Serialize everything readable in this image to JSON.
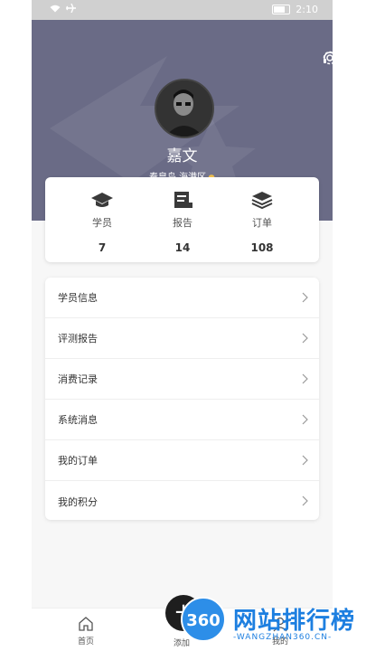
{
  "status_bar": {
    "time": "2:10"
  },
  "profile": {
    "name": "嘉文",
    "location": "秦皇岛 海港区"
  },
  "stats": [
    {
      "label": "学员",
      "value": "7",
      "icon": "graduation-cap-icon"
    },
    {
      "label": "报告",
      "value": "14",
      "icon": "report-icon"
    },
    {
      "label": "订单",
      "value": "108",
      "icon": "layers-icon"
    }
  ],
  "menu": [
    {
      "label": "学员信息"
    },
    {
      "label": "评测报告"
    },
    {
      "label": "消费记录"
    },
    {
      "label": "系统消息"
    },
    {
      "label": "我的订单"
    },
    {
      "label": "我的积分"
    }
  ],
  "tabs": [
    {
      "label": "首页",
      "icon": "home-icon"
    },
    {
      "label": "添加",
      "icon": "plus-icon"
    },
    {
      "label": "我的",
      "icon": "user-icon"
    }
  ],
  "watermark": {
    "logo": "360",
    "title": "网站排行榜",
    "sub": "-WANGZHAN360.CN-"
  },
  "colors": {
    "header_bg": "#6a6b86",
    "accent": "#1d7fe0",
    "pin": "#f2c14e"
  }
}
